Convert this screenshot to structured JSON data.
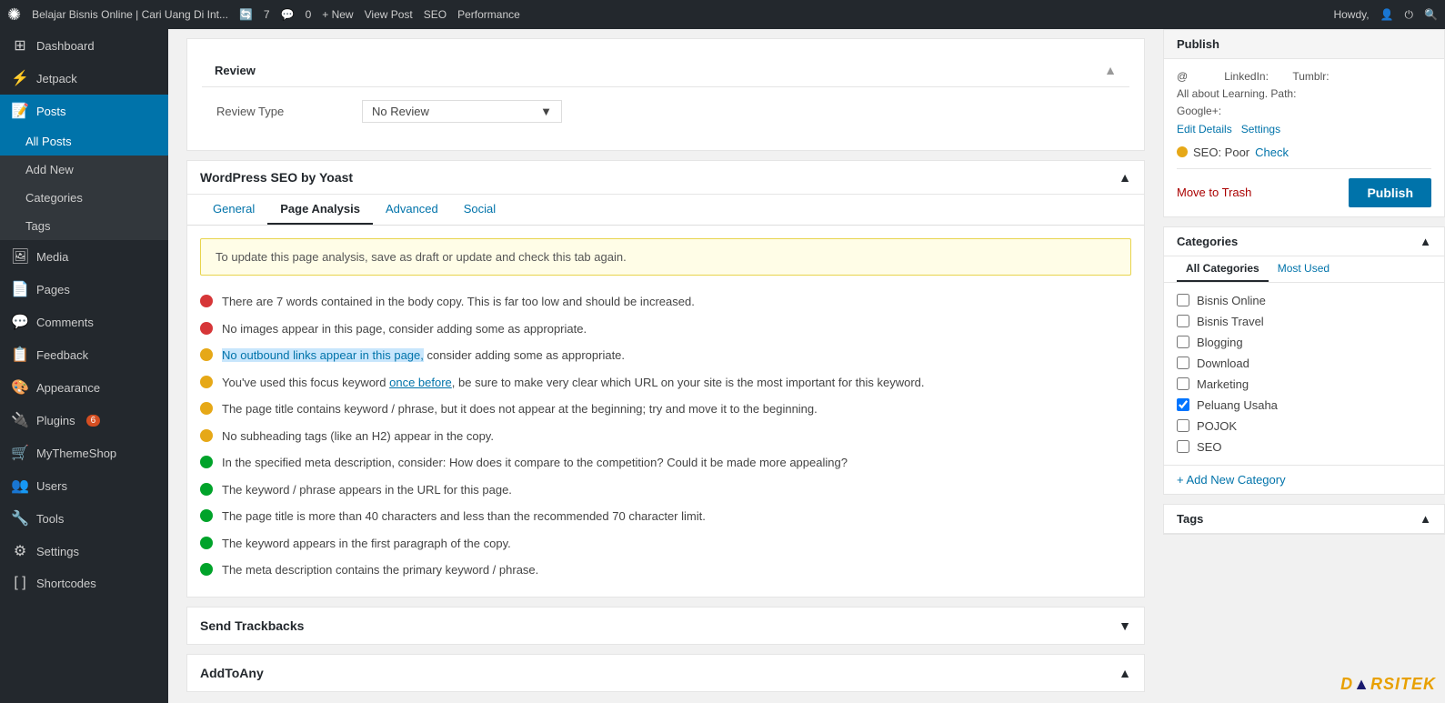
{
  "topbar": {
    "wp_logo": "✺",
    "site_name": "Belajar Bisnis Online | Cari Uang Di Int...",
    "updates": "7",
    "comments": "0",
    "new_label": "+ New",
    "view_post": "View Post",
    "seo_label": "SEO",
    "performance_label": "Performance",
    "howdy": "Howdy,",
    "right_icons": [
      "👤",
      "⏻",
      "🔍"
    ]
  },
  "sidebar": {
    "items": [
      {
        "id": "dashboard",
        "label": "Dashboard",
        "icon": "⊞"
      },
      {
        "id": "jetpack",
        "label": "Jetpack",
        "icon": "⚡"
      },
      {
        "id": "posts",
        "label": "Posts",
        "icon": "📝",
        "active": true
      },
      {
        "id": "all-posts",
        "label": "All Posts",
        "sub": true,
        "active": true
      },
      {
        "id": "add-new",
        "label": "Add New",
        "sub": true
      },
      {
        "id": "categories",
        "label": "Categories",
        "sub": true
      },
      {
        "id": "tags",
        "label": "Tags",
        "sub": true
      },
      {
        "id": "media",
        "label": "Media",
        "icon": "🖼"
      },
      {
        "id": "pages",
        "label": "Pages",
        "icon": "📄"
      },
      {
        "id": "comments",
        "label": "Comments",
        "icon": "💬"
      },
      {
        "id": "feedback",
        "label": "Feedback",
        "icon": "📋"
      },
      {
        "id": "appearance",
        "label": "Appearance",
        "icon": "🎨"
      },
      {
        "id": "plugins",
        "label": "Plugins",
        "icon": "🔌",
        "badge": "6"
      },
      {
        "id": "mythemeshop",
        "label": "MyThemeShop",
        "icon": "🛒"
      },
      {
        "id": "users",
        "label": "Users",
        "icon": "👥"
      },
      {
        "id": "tools",
        "label": "Tools",
        "icon": "🔧"
      },
      {
        "id": "settings",
        "label": "Settings",
        "icon": "⚙"
      },
      {
        "id": "shortcodes",
        "label": "Shortcodes",
        "icon": "[ ]"
      }
    ]
  },
  "main": {
    "review_section": {
      "label": "Review",
      "review_type_label": "Review Type",
      "review_type_value": "No Review"
    },
    "yoast": {
      "title": "WordPress SEO by Yoast",
      "tabs": [
        "General",
        "Page Analysis",
        "Advanced",
        "Social"
      ],
      "active_tab": "Page Analysis",
      "notice": "To update this page analysis, save as draft or update and check this tab again.",
      "checks": [
        {
          "type": "red",
          "text": "There are 7 words contained in the body copy. This is far too low and should be increased."
        },
        {
          "type": "red",
          "text": "No images appear in this page, consider adding some as appropriate."
        },
        {
          "type": "yellow",
          "text": "No outbound links appear in this page, consider adding some as appropriate.",
          "highlight": "No outbound links appear in this page,"
        },
        {
          "type": "yellow",
          "text": "You've used this focus keyword once before, be sure to make very clear which URL on your site is the most important for this keyword.",
          "link": "once before"
        },
        {
          "type": "yellow",
          "text": "The page title contains keyword / phrase, but it does not appear at the beginning; try and move it to the beginning."
        },
        {
          "type": "yellow",
          "text": "No subheading tags (like an H2) appear in the copy."
        },
        {
          "type": "green",
          "text": "In the specified meta description, consider: How does it compare to the competition? Could it be made more appealing?"
        },
        {
          "type": "green",
          "text": "The keyword / phrase appears in the URL for this page."
        },
        {
          "type": "green",
          "text": "The page title is more than 40 characters and less than the recommended 70 character limit."
        },
        {
          "type": "green",
          "text": "The keyword appears in the first paragraph of the copy."
        },
        {
          "type": "green",
          "text": "The meta description contains the primary keyword / phrase."
        }
      ]
    },
    "trackbacks": {
      "title": "Send Trackbacks"
    },
    "addtoany": {
      "title": "AddToAny"
    }
  },
  "right_sidebar": {
    "publish_box": {
      "title": "Publish",
      "author_at": "@",
      "author_linkedin": "LinkedIn:",
      "author_tumblr": "Tumblr:",
      "author_path": "All about Learning. Path:",
      "author_googleplus": "Google+:",
      "edit_details": "Edit Details",
      "settings": "Settings",
      "seo_label": "SEO: Poor",
      "seo_check": "Check",
      "move_to_trash": "Move to Trash",
      "publish_btn": "Publish"
    },
    "categories": {
      "title": "Categories",
      "tabs": [
        "All Categories",
        "Most Used"
      ],
      "items": [
        {
          "label": "Bisnis Online",
          "checked": false
        },
        {
          "label": "Bisnis Travel",
          "checked": false
        },
        {
          "label": "Blogging",
          "checked": false
        },
        {
          "label": "Download",
          "checked": false
        },
        {
          "label": "Marketing",
          "checked": false
        },
        {
          "label": "Peluang Usaha",
          "checked": true
        },
        {
          "label": "POJOK",
          "checked": false
        },
        {
          "label": "SEO",
          "checked": false
        }
      ],
      "add_category": "+ Add New Category"
    },
    "tags": {
      "title": "Tags"
    }
  }
}
